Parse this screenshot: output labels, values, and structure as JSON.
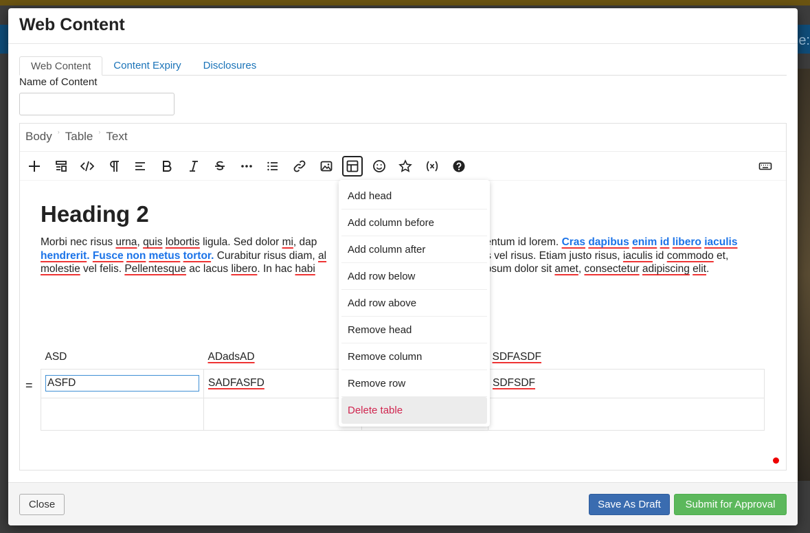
{
  "background": {
    "header_text": "e:"
  },
  "modal": {
    "title": "Web Content",
    "tabs": [
      {
        "label": "Web Content",
        "active": true
      },
      {
        "label": "Content Expiry",
        "active": false
      },
      {
        "label": "Disclosures",
        "active": false
      }
    ],
    "name_label": "Name of Content",
    "name_value": ""
  },
  "editor": {
    "breadcrumbs": [
      "Body",
      "Table",
      "Text"
    ],
    "toolbar": [
      "plus-icon",
      "block-type-icon",
      "code-icon",
      "paragraph-icon",
      "align-icon",
      "bold-icon",
      "italic-icon",
      "strikethrough-icon",
      "more-icon",
      "list-icon",
      "link-icon",
      "image-icon",
      "table-icon",
      "emoji-icon",
      "star-icon",
      "variable-icon",
      "help-icon",
      "keyboard-icon"
    ],
    "heading": "Heading 2",
    "paragraph": {
      "p1": "Morbi nec risus ",
      "p2": "urna",
      "p3": ", ",
      "p4": "quis",
      "p5": " ",
      "p6": "lobortis",
      "p7": " ligula. Sed dolor ",
      "p8": "mi",
      "p9": ", dap",
      "p10": "entum",
      "p11": " id lorem. ",
      "b1": "Cras",
      "b2": "dapibus",
      "b3": "enim",
      "b4": "id",
      "b5": "libero",
      "b6": "iaculis",
      "b7": "hendrerit",
      "b8": ". ",
      "b9": "Fusce",
      "b10": "non",
      "b11": "metus",
      "b12": "tortor",
      "b13": ".",
      "p12": " Curabitur risus diam, ",
      "p13": "al",
      "p14": "s vel risus. Etiam justo risus, ",
      "p15": "iaculis",
      "p16": " id ",
      "p17": "commodo",
      "p18": " et, ",
      "p19": "molestie",
      "p20": " vel felis. ",
      "p21": "Pellentesque",
      "p22": " ac lacus ",
      "p23": "libero",
      "p24": ". In hac ",
      "p25": "habi",
      "p26": " ipsum dolor sit ",
      "p27": "amet",
      "p28": ", ",
      "p29": "consectetur",
      "p30": " ",
      "p31": "adipiscing",
      "p32": " ",
      "p33": "elit",
      "p34": "."
    },
    "table": {
      "head": [
        "ASD",
        "ADadsAD",
        "",
        "SDFASDF"
      ],
      "rows": [
        [
          "ASFD",
          "SADFASFD",
          "",
          "SDFSDF"
        ],
        [
          "",
          "",
          "",
          ""
        ]
      ]
    },
    "row_handle": "="
  },
  "context_menu": {
    "items": [
      "Add head",
      "Add column before",
      "Add column after",
      "Add row below",
      "Add row above",
      "Remove head",
      "Remove column",
      "Remove row",
      "Delete table"
    ]
  },
  "footer": {
    "close_label": "Close",
    "draft_label": "Save As Draft",
    "submit_label": "Submit for Approval"
  },
  "colors": {
    "accent_blue": "#1a73b8",
    "draft_button": "#3a6cb0",
    "submit_button": "#5cb85c",
    "danger": "#d0254f"
  }
}
